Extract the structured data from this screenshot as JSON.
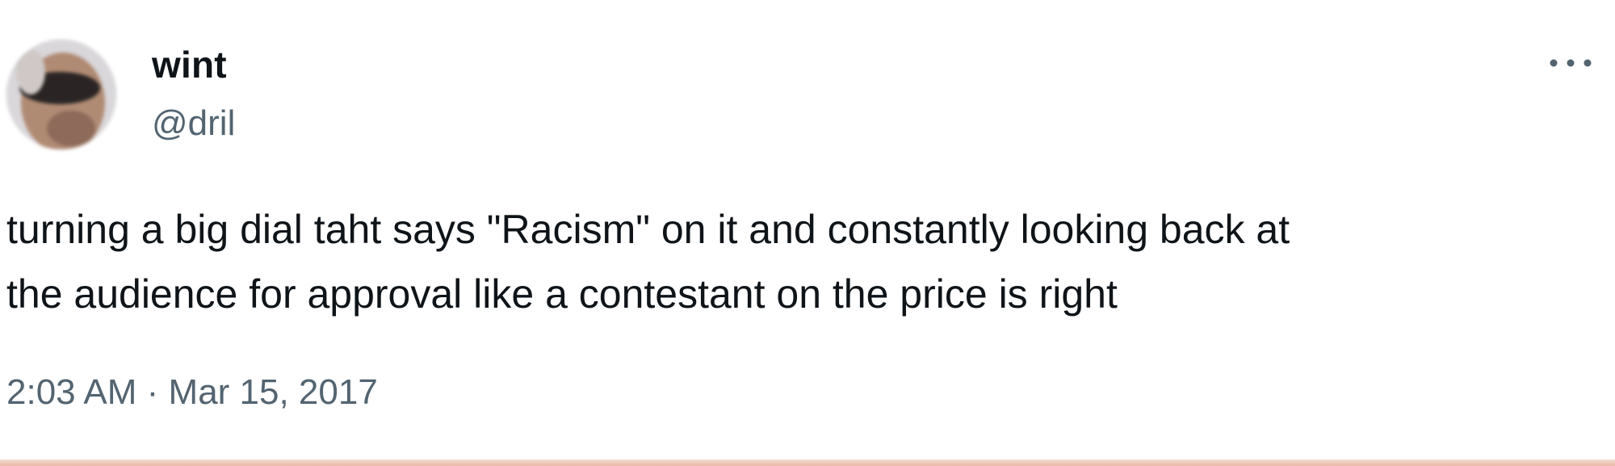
{
  "tweet": {
    "author": {
      "display_name": "wint",
      "handle": "@dril"
    },
    "text_lines": [
      "turning a big dial taht says \"Racism\" on it and constantly looking back at",
      "the audience for approval like a contestant on the price is right"
    ],
    "timestamp": "2:03 AM · Mar 15, 2017"
  },
  "icons": {
    "more": "more-horizontal-icon"
  },
  "colors": {
    "text_primary": "#0f1419",
    "text_secondary": "#536471",
    "background": "#ffffff"
  }
}
